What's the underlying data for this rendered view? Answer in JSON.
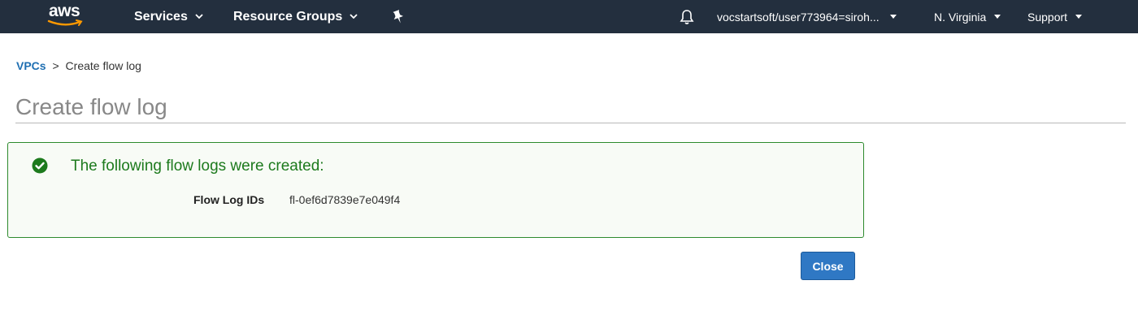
{
  "header": {
    "logo_text": "aws",
    "services_label": "Services",
    "resource_groups_label": "Resource Groups",
    "account_label": "vocstartsoft/user773964=siroh...",
    "region_label": "N. Virginia",
    "support_label": "Support",
    "icons": [
      "aws-logo",
      "chevron-down-icon",
      "pin-icon",
      "bell-icon"
    ]
  },
  "breadcrumb": {
    "parent": "VPCs",
    "separator": ">",
    "current": "Create flow log"
  },
  "page": {
    "title": "Create flow log"
  },
  "success": {
    "message": "The following flow logs were created:",
    "label": "Flow Log IDs",
    "value": "fl-0ef6d7839e7e049f4",
    "icon": "check-circle-icon",
    "color": "#1d7a1d"
  },
  "actions": {
    "close_label": "Close",
    "close_color": "#2f78c4"
  },
  "colors": {
    "topbar": "#232f3e",
    "link": "#1f6fb2"
  }
}
